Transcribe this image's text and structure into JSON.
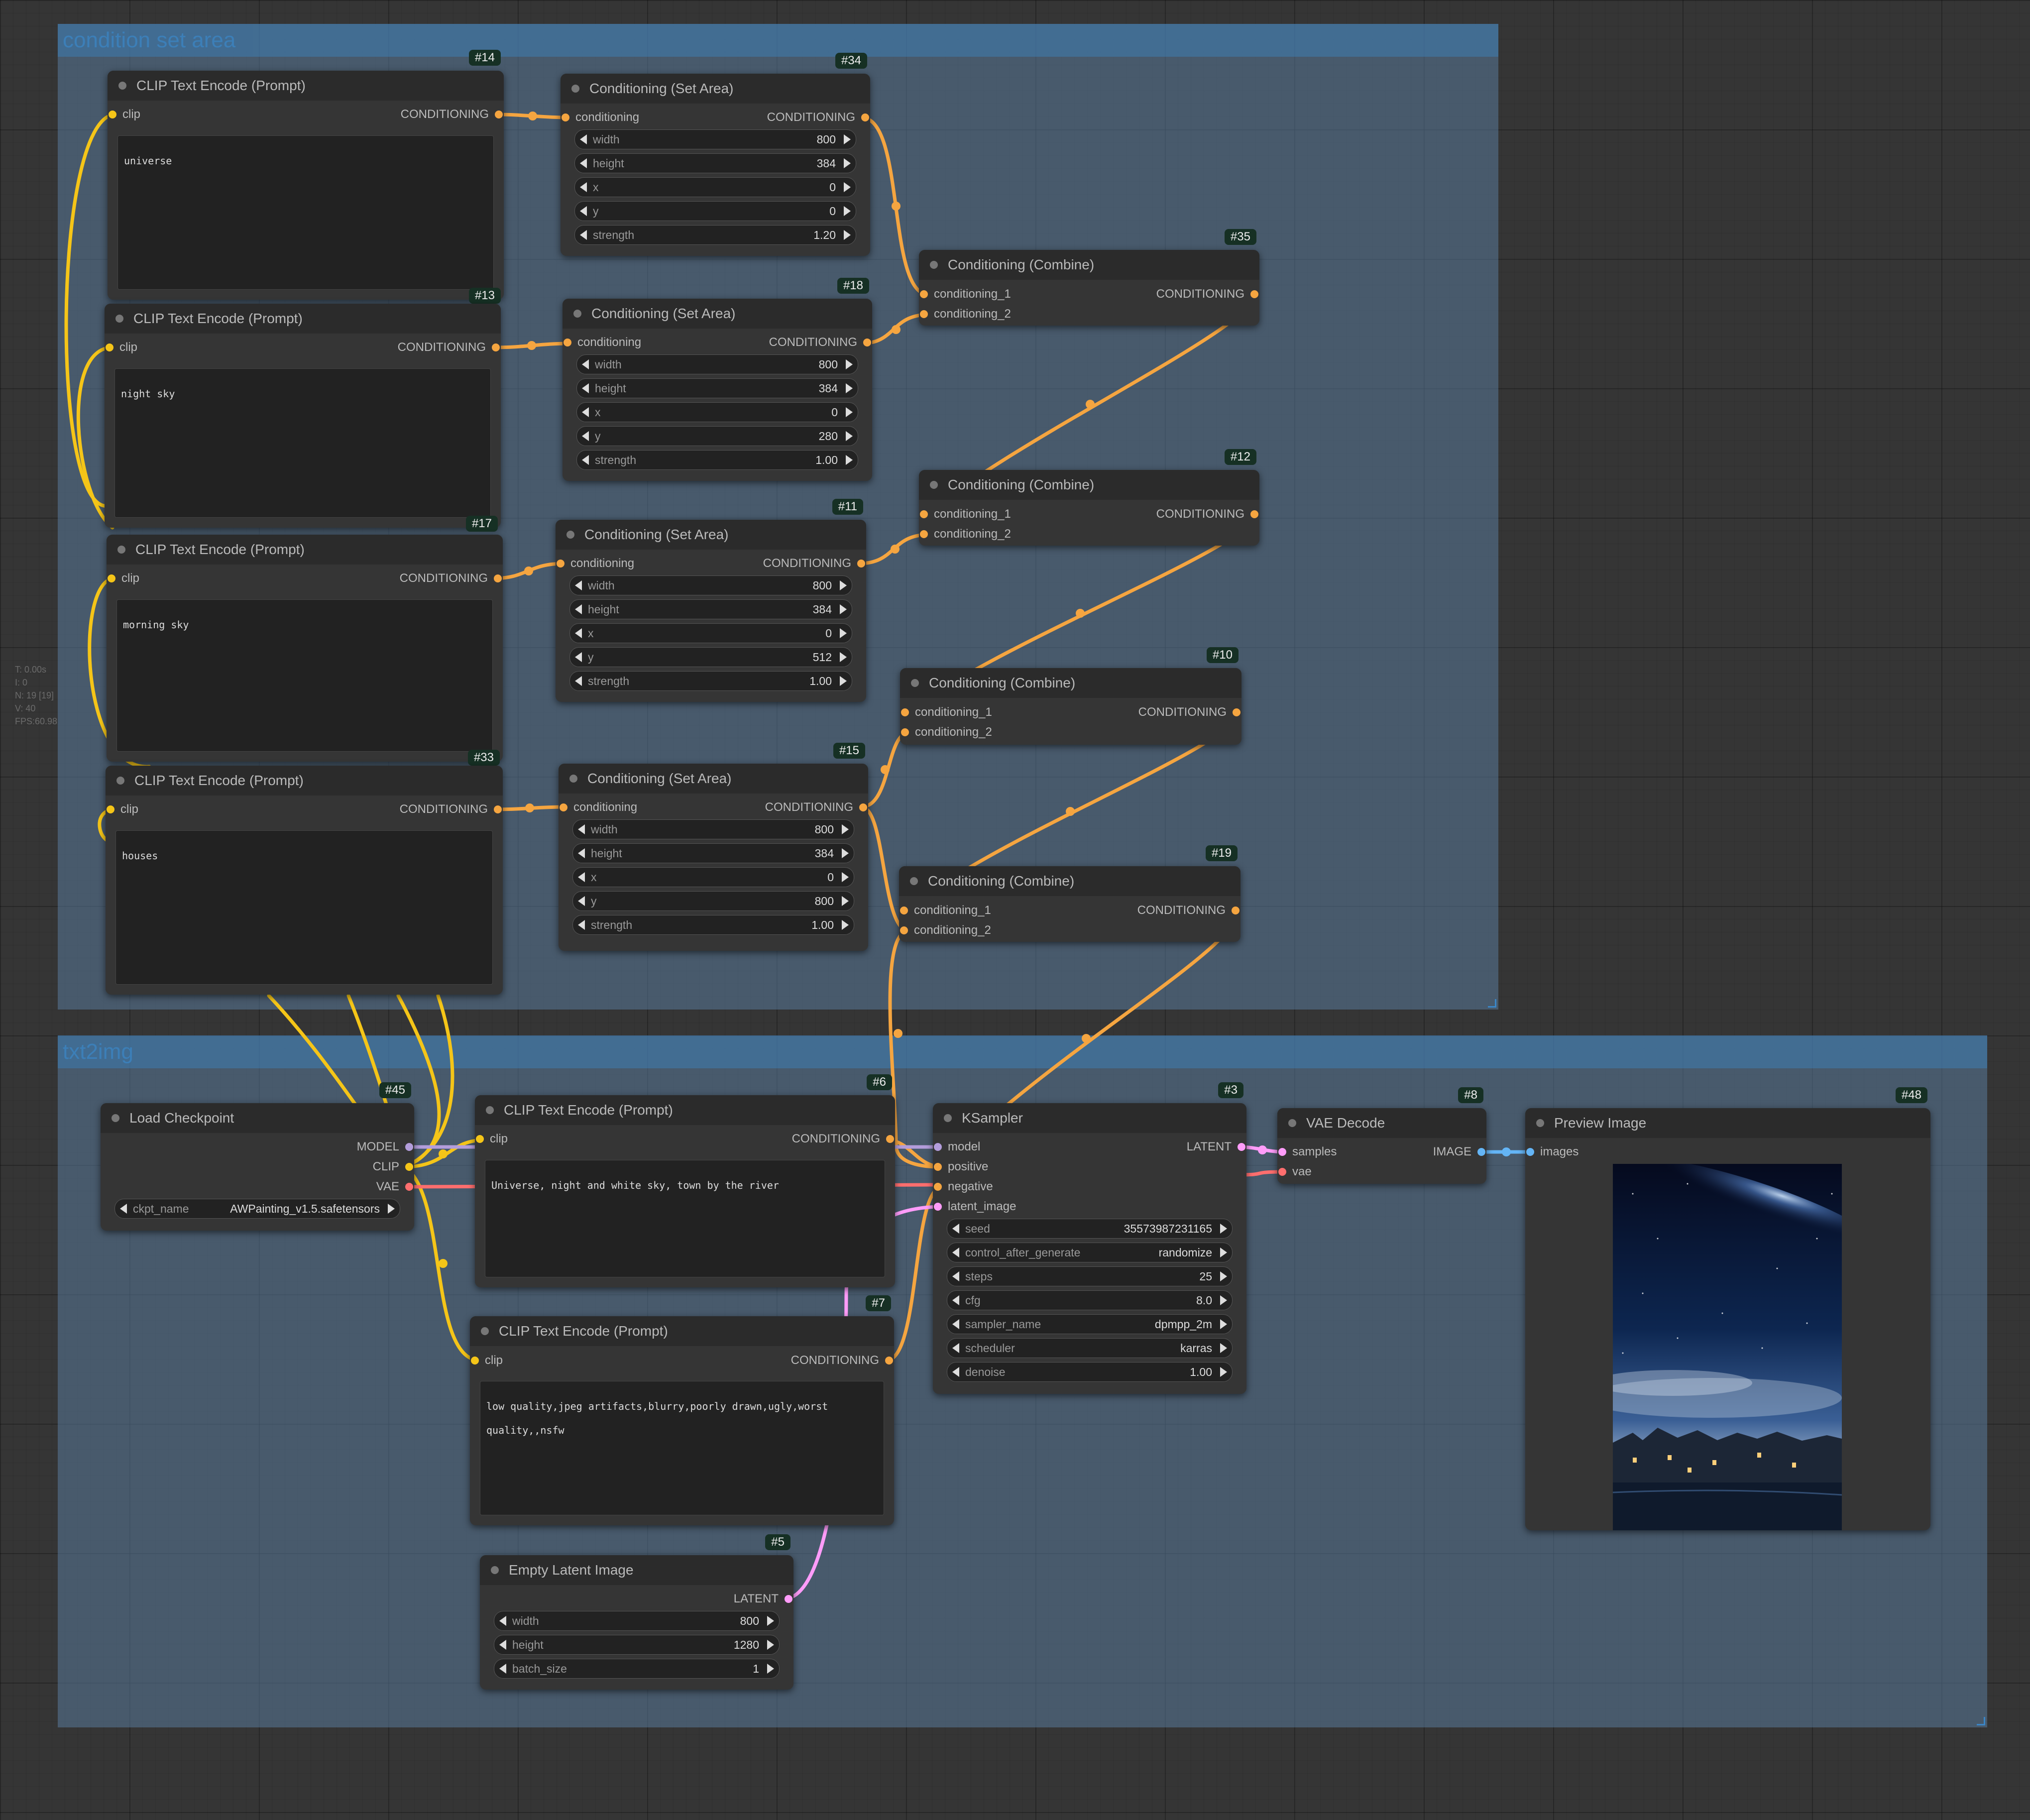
{
  "groups": [
    {
      "title": "condition set area"
    },
    {
      "title": "txt2img"
    }
  ],
  "stats": [
    "T: 0.00s",
    "I: 0",
    "N: 19 [19]",
    "V: 40",
    "FPS:60.98"
  ],
  "colors": {
    "clip": "#f5c518",
    "conditioning": "#f5a540",
    "model": "#b39ddb",
    "vae": "#ff6e6e",
    "latent": "#ff9cf9",
    "image": "#64b5f6"
  },
  "nodes": {
    "n14": {
      "id": "#14",
      "title": "CLIP Text Encode (Prompt)",
      "in": "clip",
      "out": "CONDITIONING",
      "text": "universe",
      "bottom_badge": "#13"
    },
    "n13": {
      "id": "#13",
      "title": "CLIP Text Encode (Prompt)",
      "in": "clip",
      "out": "CONDITIONING",
      "text": "night sky",
      "bottom_badge": "#17"
    },
    "n17": {
      "id": "#17",
      "title": "CLIP Text Encode (Prompt)",
      "in": "clip",
      "out": "CONDITIONING",
      "text": "morning sky",
      "bottom_badge": "#33"
    },
    "n33": {
      "id": "#33",
      "title": "CLIP Text Encode (Prompt)",
      "in": "clip",
      "out": "CONDITIONING",
      "text": "houses"
    },
    "n34": {
      "id": "#34",
      "title": "Conditioning (Set Area)",
      "in": "conditioning",
      "out": "CONDITIONING",
      "widgets": [
        [
          "width",
          "800"
        ],
        [
          "height",
          "384"
        ],
        [
          "x",
          "0"
        ],
        [
          "y",
          "0"
        ],
        [
          "strength",
          "1.20"
        ]
      ]
    },
    "n18": {
      "id": "#18",
      "title": "Conditioning (Set Area)",
      "in": "conditioning",
      "out": "CONDITIONING",
      "widgets": [
        [
          "width",
          "800"
        ],
        [
          "height",
          "384"
        ],
        [
          "x",
          "0"
        ],
        [
          "y",
          "280"
        ],
        [
          "strength",
          "1.00"
        ]
      ]
    },
    "n11": {
      "id": "#11",
      "title": "Conditioning (Set Area)",
      "in": "conditioning",
      "out": "CONDITIONING",
      "widgets": [
        [
          "width",
          "800"
        ],
        [
          "height",
          "384"
        ],
        [
          "x",
          "0"
        ],
        [
          "y",
          "512"
        ],
        [
          "strength",
          "1.00"
        ]
      ]
    },
    "n15": {
      "id": "#15",
      "title": "Conditioning (Set Area)",
      "in": "conditioning",
      "out": "CONDITIONING",
      "widgets": [
        [
          "width",
          "800"
        ],
        [
          "height",
          "384"
        ],
        [
          "x",
          "0"
        ],
        [
          "y",
          "800"
        ],
        [
          "strength",
          "1.00"
        ]
      ]
    },
    "n35": {
      "id": "#35",
      "title": "Conditioning (Combine)",
      "in1": "conditioning_1",
      "in2": "conditioning_2",
      "out": "CONDITIONING"
    },
    "n12": {
      "id": "#12",
      "title": "Conditioning (Combine)",
      "in1": "conditioning_1",
      "in2": "conditioning_2",
      "out": "CONDITIONING"
    },
    "n10": {
      "id": "#10",
      "title": "Conditioning (Combine)",
      "in1": "conditioning_1",
      "in2": "conditioning_2",
      "out": "CONDITIONING"
    },
    "n19": {
      "id": "#19",
      "title": "Conditioning (Combine)",
      "in1": "conditioning_1",
      "in2": "conditioning_2",
      "out": "CONDITIONING"
    },
    "n45": {
      "id": "#45",
      "title": "Load Checkpoint",
      "outs": [
        "MODEL",
        "CLIP",
        "VAE"
      ],
      "widgets": [
        [
          "ckpt_name",
          "AWPainting_v1.5.safetensors"
        ]
      ]
    },
    "n6": {
      "id": "#6",
      "title": "CLIP Text Encode (Prompt)",
      "in": "clip",
      "out": "CONDITIONING",
      "text": "Universe, night and white sky, town by the river"
    },
    "n7": {
      "id": "#7",
      "title": "CLIP Text Encode (Prompt)",
      "in": "clip",
      "out": "CONDITIONING",
      "text": "low quality,jpeg artifacts,blurry,poorly drawn,ugly,worst\nquality,,nsfw"
    },
    "n5": {
      "id": "#5",
      "title": "Empty Latent Image",
      "out": "LATENT",
      "widgets": [
        [
          "width",
          "800"
        ],
        [
          "height",
          "1280"
        ],
        [
          "batch_size",
          "1"
        ]
      ]
    },
    "n3": {
      "id": "#3",
      "title": "KSampler",
      "ins": [
        "model",
        "positive",
        "negative",
        "latent_image"
      ],
      "out": "LATENT",
      "widgets": [
        [
          "seed",
          "35573987231165"
        ],
        [
          "control_after_generate",
          "randomize"
        ],
        [
          "steps",
          "25"
        ],
        [
          "cfg",
          "8.0"
        ],
        [
          "sampler_name",
          "dpmpp_2m"
        ],
        [
          "scheduler",
          "karras"
        ],
        [
          "denoise",
          "1.00"
        ]
      ]
    },
    "n8": {
      "id": "#8",
      "title": "VAE Decode",
      "ins": [
        "samples",
        "vae"
      ],
      "out": "IMAGE"
    },
    "n48": {
      "id": "#48",
      "title": "Preview Image",
      "in": "images"
    }
  }
}
